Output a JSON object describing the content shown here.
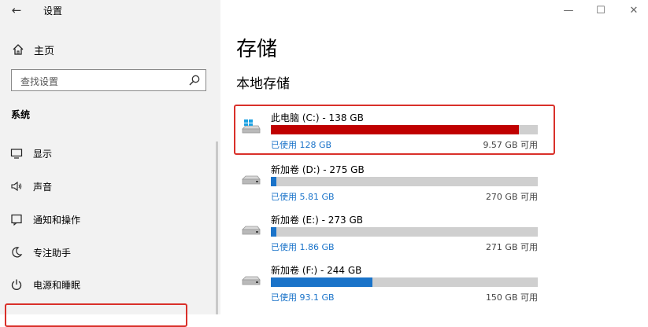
{
  "window": {
    "title": "设置",
    "back_icon": "←",
    "min": "—",
    "max": "☐",
    "close": "✕"
  },
  "sidebar": {
    "home_label": "主页",
    "search_placeholder": "查找设置",
    "section_label": "系统",
    "items": [
      {
        "label": "显示",
        "icon": "display-icon"
      },
      {
        "label": "声音",
        "icon": "speaker-icon"
      },
      {
        "label": "通知和操作",
        "icon": "notification-icon"
      },
      {
        "label": "专注助手",
        "icon": "moon-icon"
      },
      {
        "label": "电源和睡眠",
        "icon": "power-icon"
      }
    ]
  },
  "main": {
    "title": "存储",
    "subtitle": "本地存储",
    "drives": [
      {
        "name": "此电脑 (C:) - 138 GB",
        "used": "已使用 128 GB",
        "free": "9.57 GB 可用",
        "used_fraction": 0.928,
        "bar_color": "#c00000",
        "icon": "windows-drive-icon"
      },
      {
        "name": "新加卷 (D:) - 275 GB",
        "used": "已使用 5.81 GB",
        "free": "270 GB 可用",
        "used_fraction": 0.021,
        "bar_color": "#1a73c9",
        "icon": "drive-icon"
      },
      {
        "name": "新加卷 (E:) - 273 GB",
        "used": "已使用 1.86 GB",
        "free": "271 GB 可用",
        "used_fraction": 0.007,
        "bar_color": "#1a73c9",
        "icon": "drive-icon"
      },
      {
        "name": "新加卷 (F:) - 244 GB",
        "used": "已使用 93.1 GB",
        "free": "150 GB 可用",
        "used_fraction": 0.382,
        "bar_color": "#1a73c9",
        "icon": "drive-icon"
      }
    ]
  },
  "colors": {
    "highlight": "#d9302a",
    "accent": "#1a73c9",
    "critical": "#c00000"
  }
}
